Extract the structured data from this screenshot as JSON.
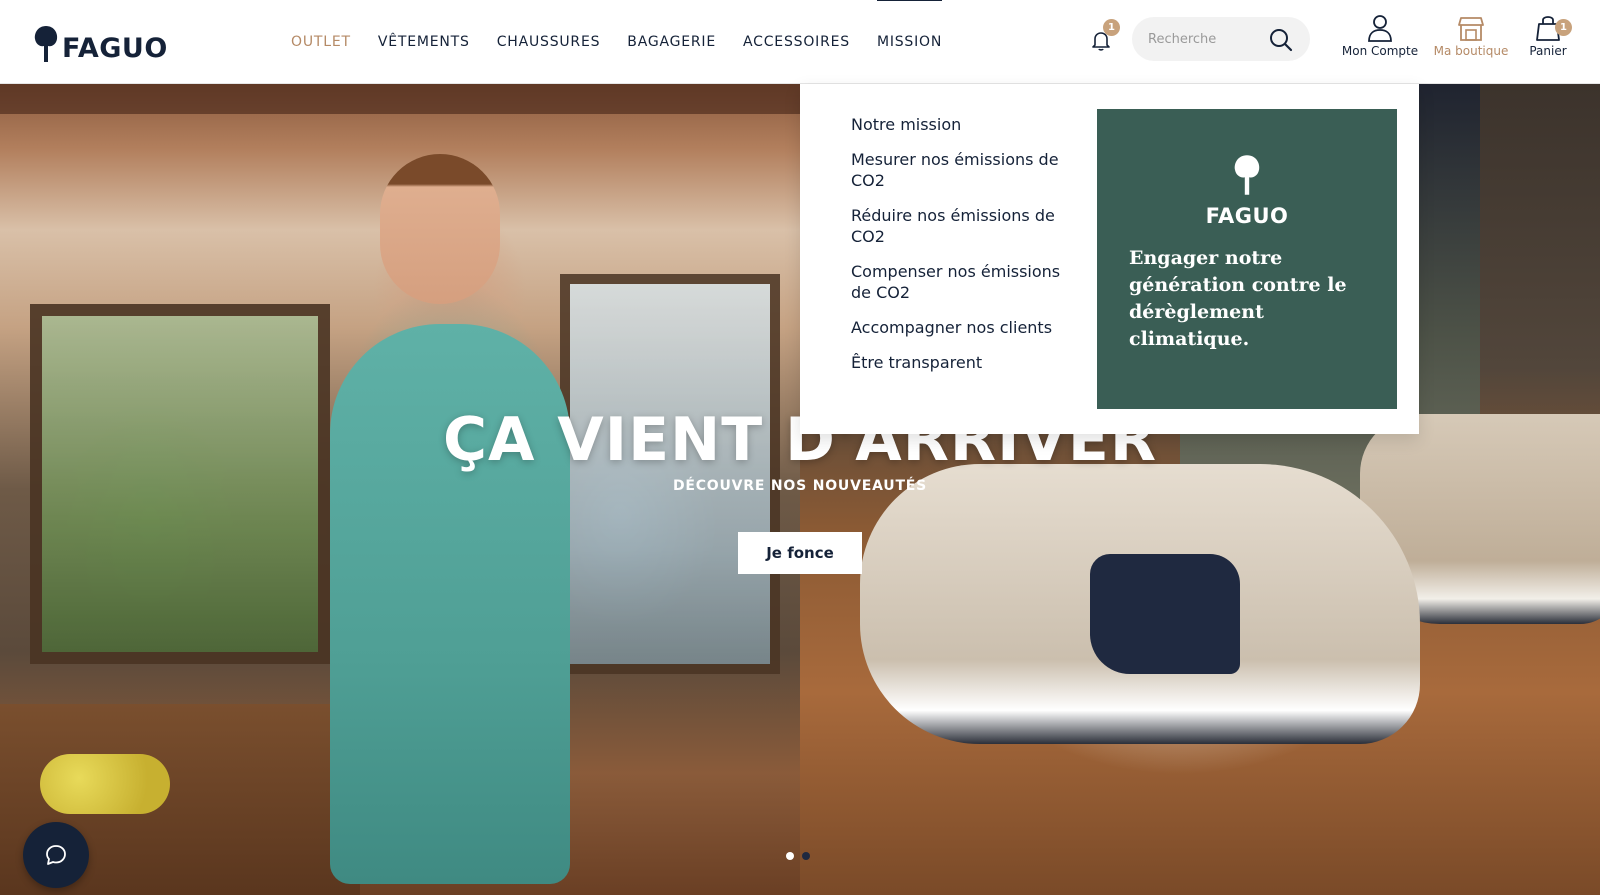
{
  "brand": {
    "name": "FAGUO"
  },
  "nav": [
    {
      "label": "OUTLET"
    },
    {
      "label": "VÊTEMENTS"
    },
    {
      "label": "CHAUSSURES"
    },
    {
      "label": "BAGAGERIE"
    },
    {
      "label": "ACCESSOIRES"
    },
    {
      "label": "MISSION"
    }
  ],
  "header": {
    "notifications_count": "1",
    "search_placeholder": "Recherche",
    "account_label": "Mon Compte",
    "store_label": "Ma boutique",
    "cart_label": "Panier",
    "cart_count": "1",
    "icons": [
      "bell-icon",
      "search-icon",
      "user-icon",
      "store-icon",
      "bag-icon"
    ]
  },
  "mission_menu": {
    "items": [
      {
        "label": "Notre mission"
      },
      {
        "label": "Mesurer nos émissions de CO2"
      },
      {
        "label": "Réduire nos émissions de CO2"
      },
      {
        "label": "Compenser nos émissions de CO2"
      },
      {
        "label": "Accompagner nos clients"
      },
      {
        "label": "Être transparent"
      }
    ],
    "card": {
      "brand": "FAGUO",
      "text": "Engager notre génération contre le dérèglement climatique.",
      "color": "#3a5e55"
    }
  },
  "hero": {
    "title": "ÇA VIENT D'ARRIVER",
    "subtitle": "DÉCOUVRE NOS NOUVEAUTÉS",
    "cta": "Je fonce",
    "slide_count": 2,
    "active_slide": 1
  },
  "chat": {
    "icon": "chat-icon"
  },
  "colors": {
    "navy": "#152238",
    "accent": "#b58a66",
    "badge": "#c8a27c",
    "card_green": "#3a5e55"
  }
}
